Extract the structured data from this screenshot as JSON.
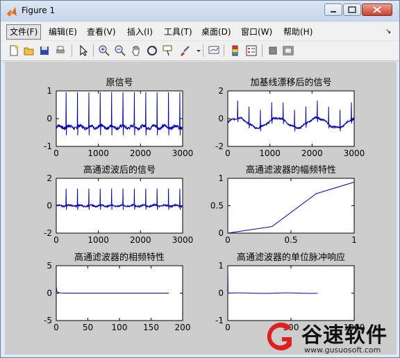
{
  "window": {
    "title": "Figure 1"
  },
  "menubar": {
    "items": [
      {
        "label": "文件(F)"
      },
      {
        "label": "编辑(E)"
      },
      {
        "label": "查看(V)"
      },
      {
        "label": "插入(I)"
      },
      {
        "label": "工具(T)"
      },
      {
        "label": "桌面(D)"
      },
      {
        "label": "窗口(W)"
      },
      {
        "label": "帮助(H)"
      }
    ]
  },
  "toolbar": {
    "icons": [
      "new-figure-icon",
      "open-file-icon",
      "save-icon",
      "print-icon",
      "pointer-icon",
      "zoom-in-icon",
      "zoom-out-icon",
      "pan-hand-icon",
      "rotate-3d-icon",
      "data-cursor-icon",
      "brush-icon",
      "link-plot-icon",
      "colorbar-icon",
      "legend-icon",
      "hide-plot-tools-icon",
      "show-plot-tools-icon"
    ]
  },
  "colors": {
    "line": "#0000a8",
    "figure_bg": "#cccccc",
    "axes_bg": "#ffffff"
  },
  "chart_data": [
    {
      "type": "line",
      "title": "原信号",
      "xlim": [
        0,
        3000
      ],
      "ylim": [
        -1,
        1
      ],
      "xticks": [
        "0",
        "1000",
        "2000",
        "3000"
      ],
      "yticks": [
        "1",
        "0",
        "-1"
      ],
      "series": [
        {
          "values": "ECG-like spikes ~0.95 peaks, baseline -0.3 noise"
        }
      ]
    },
    {
      "type": "line",
      "title": "加基线漂移后的信号",
      "xlim": [
        0,
        3000
      ],
      "ylim": [
        -2,
        2
      ],
      "xticks": [
        "0",
        "1000",
        "2000",
        "3000"
      ],
      "yticks": [
        "2",
        "0",
        "-2"
      ]
    },
    {
      "type": "line",
      "title": "高通滤波后的信号",
      "xlim": [
        0,
        3000
      ],
      "ylim": [
        -2,
        2
      ],
      "xticks": [
        "0",
        "1000",
        "2000",
        "3000"
      ],
      "yticks": [
        "2",
        "0",
        "-2"
      ]
    },
    {
      "type": "line",
      "title": "高通滤波器的幅频特性",
      "xlim": [
        0,
        1
      ],
      "ylim": [
        0,
        1
      ],
      "xticks": [
        "0",
        "0.5",
        "1"
      ],
      "yticks": [
        "1",
        "0.5",
        "0"
      ],
      "x": [
        0,
        0.35,
        0.7,
        1
      ],
      "y": [
        0,
        0.12,
        0.72,
        0.93
      ]
    },
    {
      "type": "line",
      "title": "高通滤波器的相频特性",
      "xlim": [
        0,
        200
      ],
      "ylim": [
        -5,
        5
      ],
      "xticks": [
        "0",
        "50",
        "100",
        "150",
        "200"
      ],
      "yticks": [
        "5",
        "0",
        "-5"
      ]
    },
    {
      "type": "line",
      "title": "高通滤波器的单位脉冲响应",
      "xlim": [
        0,
        1000
      ],
      "ylim": [
        -1,
        1
      ],
      "xticks": [
        "0",
        "500",
        "1000"
      ],
      "yticks": [
        "1",
        "0",
        "-1"
      ]
    }
  ],
  "watermark": {
    "name": "谷速软件",
    "url": "www.gusuosoft.com"
  }
}
